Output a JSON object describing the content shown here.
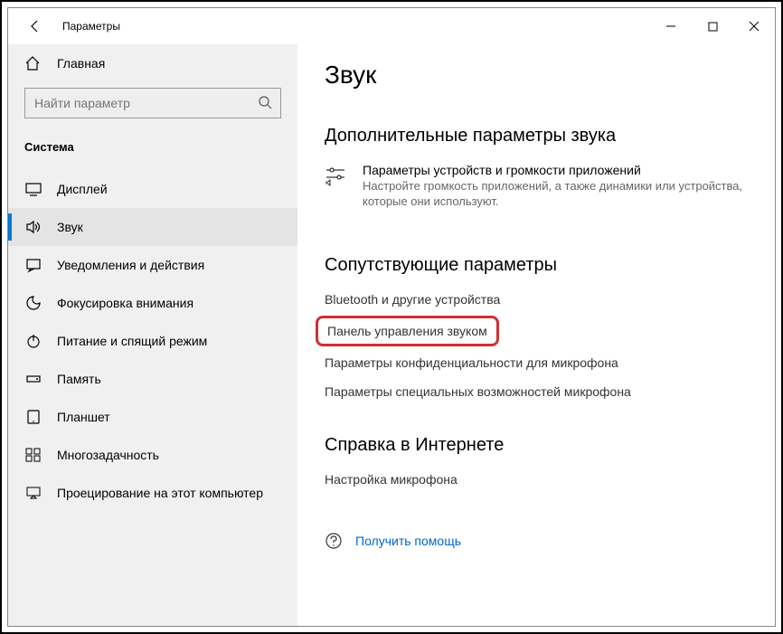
{
  "titlebar": {
    "app_title": "Параметры"
  },
  "sidebar": {
    "home": "Главная",
    "search_placeholder": "Найти параметр",
    "section": "Система",
    "items": [
      {
        "label": "Дисплей"
      },
      {
        "label": "Звук"
      },
      {
        "label": "Уведомления и действия"
      },
      {
        "label": "Фокусировка внимания"
      },
      {
        "label": "Питание и спящий режим"
      },
      {
        "label": "Память"
      },
      {
        "label": "Планшет"
      },
      {
        "label": "Многозадачность"
      },
      {
        "label": "Проецирование на этот компьютер"
      }
    ]
  },
  "main": {
    "title": "Звук",
    "group1": {
      "heading": "Дополнительные параметры звука",
      "item_title": "Параметры устройств и громкости приложений",
      "item_desc": "Настройте громкость приложений, а также динамики или устройства, которые они используют."
    },
    "group2": {
      "heading": "Сопутствующие параметры",
      "links": [
        "Bluetooth и другие устройства",
        "Панель управления звуком",
        "Параметры конфиденциальности для микрофона",
        "Параметры специальных возможностей микрофона"
      ]
    },
    "group3": {
      "heading": "Справка в Интернете",
      "link": "Настройка микрофона"
    },
    "help": "Получить помощь"
  }
}
